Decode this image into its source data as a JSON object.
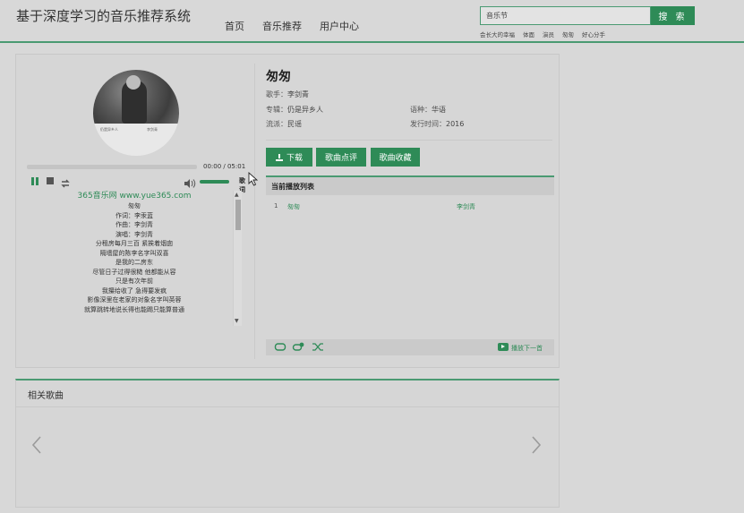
{
  "header": {
    "site_title": "基于深度学习的音乐推荐系统",
    "nav": [
      "首页",
      "音乐推荐",
      "用户中心"
    ],
    "search": {
      "value": "音乐节",
      "button_label": "搜 索"
    },
    "hot_tags": [
      "会长大的幸福",
      "体面",
      "演员",
      "匆匆",
      "好心分手"
    ]
  },
  "player": {
    "album": {
      "caption_left": "仍是异乡人",
      "caption_right": "李剑青"
    },
    "time": "00:00 / 05:01",
    "lyric_toggle": "歌词",
    "lyrics_site": "365音乐网 www.yue365.com",
    "lyrics": [
      "匆匆",
      "作词：李汞蓝",
      "作曲：李剑青",
      "演唱：李剑青",
      "分租房每月三百 紧挨着烟囱",
      "隔墙屋的陈李名字叫双喜",
      "是我的二房东",
      "尽管日子过得很糙 他都能从容",
      "只是有次年前",
      "我攥给收了 急得要发疯",
      "影像深里在老家的对象名字叫英蓉",
      "就算跳转地说长得也能踢只能算普通"
    ]
  },
  "song": {
    "title": "匆匆",
    "singer_label": "歌手：",
    "singer": "李剑青",
    "album_label": "专辑：",
    "album": "仍是异乡人",
    "genre_label": "流派：",
    "genre": "民谣",
    "language_label": "语种：",
    "language": "华语",
    "release_label": "发行时间：",
    "release": "2016"
  },
  "actions": {
    "download": "下载",
    "review": "歌曲点评",
    "favorite": "歌曲收藏"
  },
  "playlist": {
    "title": "当前播放列表",
    "rows": [
      {
        "index": "1",
        "name": "匆匆",
        "singer": "李剑青"
      }
    ],
    "next_label": "播放下一首"
  },
  "related": {
    "title": "相关歌曲"
  },
  "colors": {
    "accent": "#2e8b57",
    "background": "#d8d8d8"
  }
}
